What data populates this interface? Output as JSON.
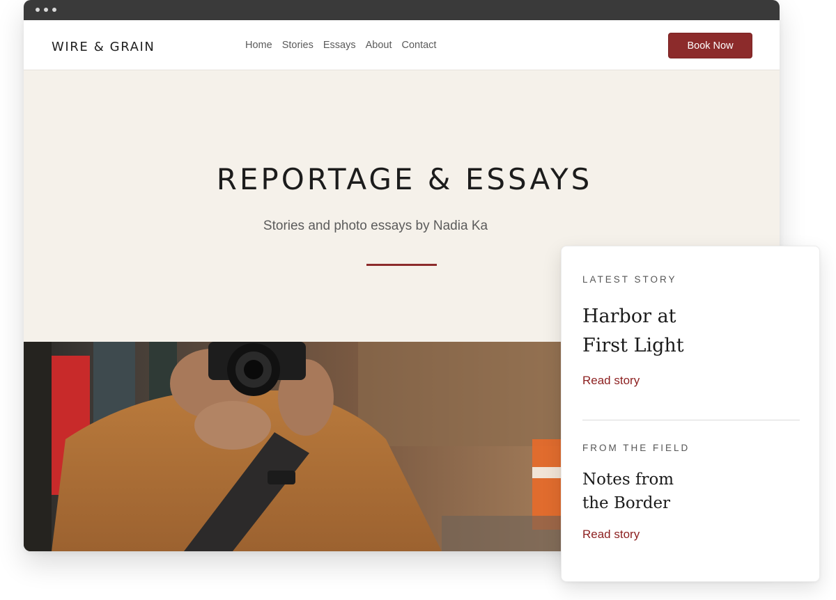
{
  "brand": {
    "logo": "WIRE & GRAIN",
    "accent_color": "#8c2b2b"
  },
  "nav": {
    "links": [
      "Home",
      "Stories",
      "Essays",
      "About",
      "Contact"
    ],
    "cta_label": "Book Now"
  },
  "hero": {
    "title": "REPORTAGE & ESSAYS",
    "subtitle": "Stories and photo essays by Nadia Ka",
    "background": "#f5f1ea"
  },
  "sidebar_card": {
    "sections": [
      {
        "kicker": "LATEST STORY",
        "title_line1": "Harbor at",
        "title_line2": "First Light",
        "link": "Read story"
      },
      {
        "kicker": "FROM THE FIELD",
        "title_line1": "Notes from",
        "title_line2": "the Border",
        "link": "Read story"
      }
    ]
  },
  "icons": {
    "window_controls": "traffic-dots"
  }
}
